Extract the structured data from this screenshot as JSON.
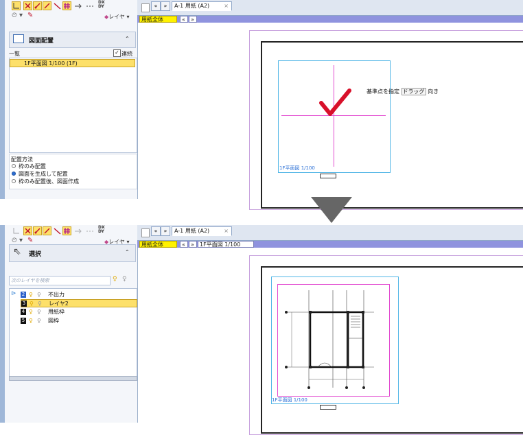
{
  "toolbar": {
    "layer_label": "レイヤ",
    "dxdy_top": "DX",
    "dxdy_bottom": "DY"
  },
  "top": {
    "tabs": {
      "prev": "«",
      "next": "»",
      "active": "A-1 用紙 (A2)",
      "close": "×"
    },
    "view_button": "用紙全体",
    "view_nav_prev": "«",
    "view_nav_next": "»",
    "panel_title": "図面配置",
    "list_label": "一覧",
    "continuous_label": "連続",
    "list_items": [
      "1F平面図 1/100 (1F)"
    ],
    "placement_title": "配置方法",
    "placement_options": [
      "枠のみ配置",
      "図面を生成して配置",
      "枠のみ配置後、図面作成"
    ],
    "placement_selected": 1,
    "instruction": "基準点を指定",
    "instruction_drag": "ドラッグ",
    "instruction_dir": "向き",
    "caption": "1F平面図 1/100"
  },
  "bottom": {
    "tabs": {
      "prev": "«",
      "next": "»",
      "active": "A-1 用紙 (A2)",
      "close": "×"
    },
    "view_button": "用紙全体",
    "view_nav_prev": "«",
    "view_nav_next": "»",
    "view_drawing_chip": "1F平面図 1/100",
    "panel_title": "選択",
    "search_placeholder": "次のレイヤを検索",
    "layers": [
      {
        "num": "2",
        "name": "不出力",
        "selected": false
      },
      {
        "num": "3",
        "name": "レイヤ2",
        "selected": true
      },
      {
        "num": "4",
        "name": "用紙枠",
        "selected": false
      },
      {
        "num": "5",
        "name": "図枠",
        "selected": false
      }
    ],
    "caption": "1F平面図 1/100"
  },
  "colors": {
    "highlight": "#fde06a",
    "check": "#d8102a",
    "magenta": "#e24ad0",
    "frame": "#4fb5e6"
  }
}
